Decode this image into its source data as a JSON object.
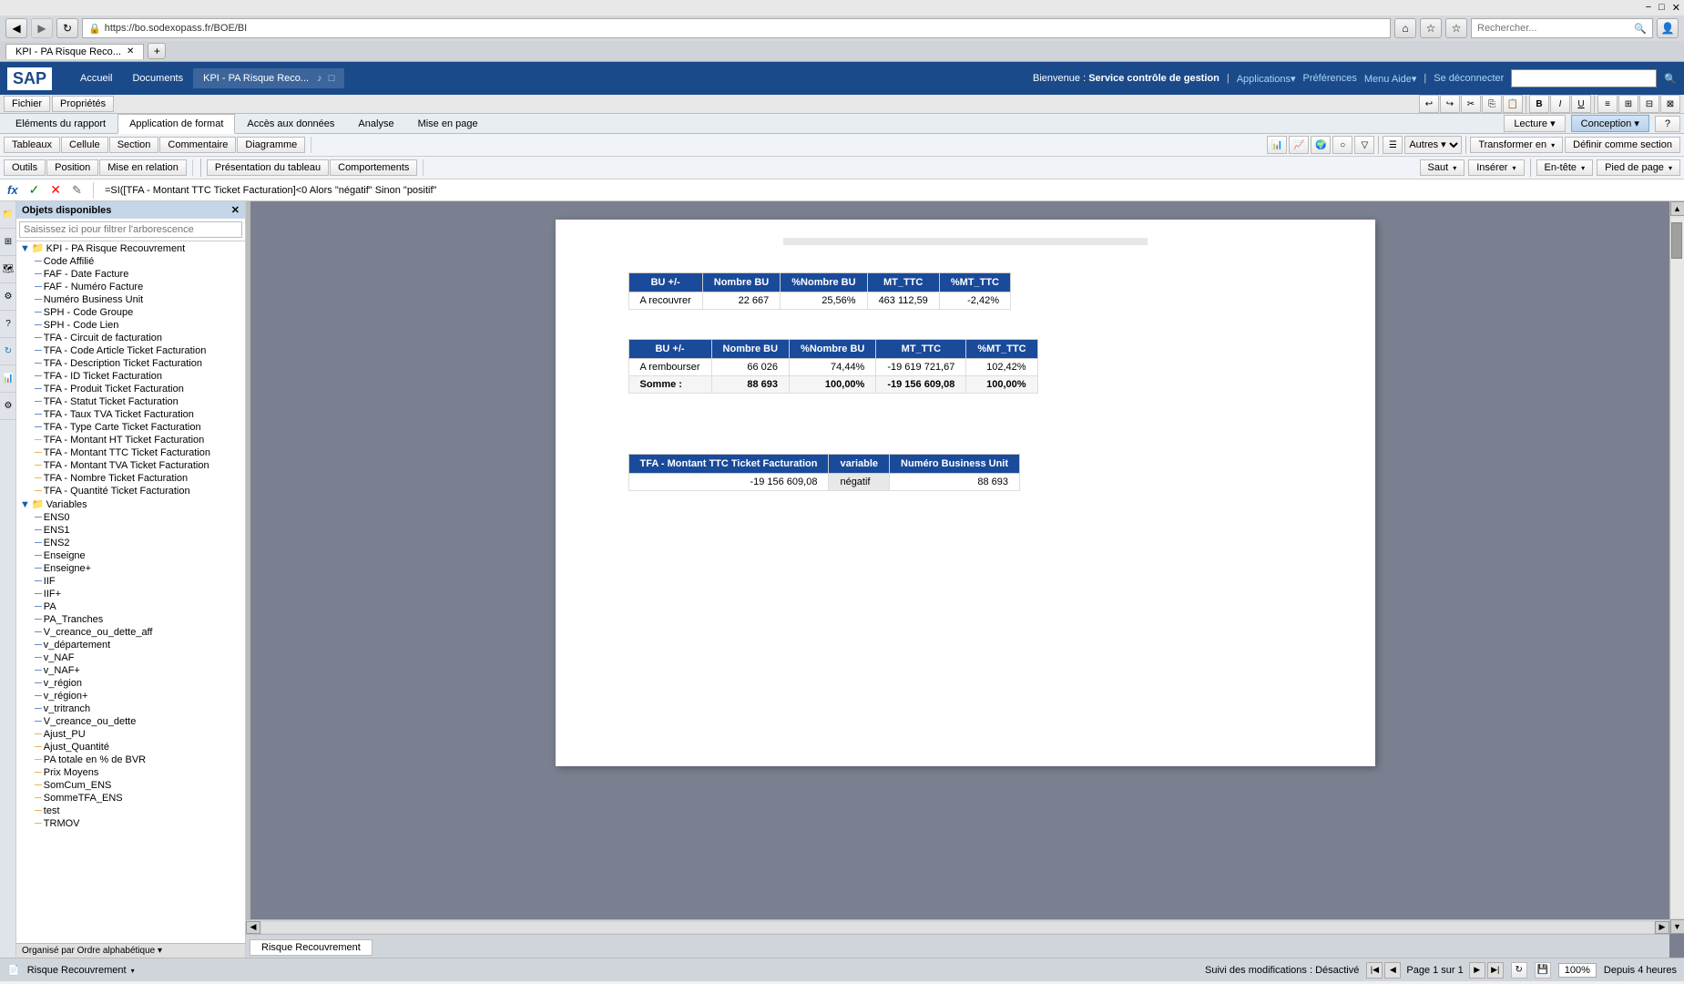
{
  "browser": {
    "url": "https://bo.sodexopass.fr/BOE/BI",
    "search_placeholder": "Rechercher...",
    "tab_title": "KPI - PA Risque Reco...",
    "minimize": "−",
    "maximize": "□",
    "close": "✕",
    "nav_back": "◀",
    "nav_forward": "▶",
    "nav_reload": "↻",
    "nav_home": "⌂",
    "fav_star": "☆",
    "fav_star2": "☆",
    "user_icon": "👤"
  },
  "sap": {
    "logo": "SAP",
    "welcome": "Bienvenue : Service contrôle de gestion",
    "menu_items": [
      "Accueil",
      "Documents"
    ],
    "kpi_tab": "KPI - PA Risque Reco...",
    "links": [
      "Applications▾",
      "Préférences",
      "Menu Aide▾",
      "|",
      "Se déconnecter"
    ]
  },
  "ribbon": {
    "tabs": [
      "Fichier",
      "Propriétés"
    ],
    "main_tabs": [
      "Eléments du rapport",
      "Application de format",
      "Accès aux données",
      "Analyse",
      "Mise en page"
    ],
    "active_main_tab": "Application de format",
    "sub_tabs1": [
      "Tableaux",
      "Cellule",
      "Section",
      "Commentaire",
      "Diagramme"
    ],
    "sub_tabs2_tools": [
      "Outils",
      "Position",
      "Mise en relation"
    ],
    "sub_tabs3": [
      "Présentation du tableau",
      "Comportements"
    ],
    "mode_buttons": [
      "Lecture",
      "Conception"
    ],
    "active_mode": "Conception",
    "help": "?"
  },
  "toolbar": {
    "formatting_btns": [
      "B",
      "I",
      "U"
    ],
    "insert_section": "Saut ▾",
    "insert": "Insérer ▾",
    "header": "En-tête ▾",
    "footer": "Pied de page ▾",
    "transform": "Transformer en ▾",
    "define_section": "Définir comme section",
    "others": "Autres ▾"
  },
  "formula_bar": {
    "fx": "fx",
    "check": "✓",
    "cancel": "✕",
    "formula": "=SI([TFA - Montant TTC Ticket Facturation]<0 Alors \"négatif\" Sinon \"positif\""
  },
  "left_panel": {
    "title": "Objets disponibles",
    "search_placeholder": "Saisissez ici pour filtrer l'arborescence",
    "root": "KPI - PA Risque Recouvrement",
    "items": [
      "Code Affilié",
      "FAF - Date Facture",
      "FAF - Numéro Facture",
      "Numéro Business Unit",
      "SPH - Code Groupe",
      "SPH - Code Lien",
      "TFA - Circuit de facturation",
      "TFA - Code Article Ticket Facturation",
      "TFA - Description Ticket Facturation",
      "TFA - ID Ticket Facturation",
      "TFA - Produit Ticket Facturation",
      "TFA - Statut Ticket Facturation",
      "TFA - Taux TVA Ticket Facturation",
      "TFA - Type Carte Ticket Facturation",
      "TFA - Montant HT Ticket Facturation",
      "TFA - Montant TTC Ticket Facturation",
      "TFA - Montant TVA Ticket Facturation",
      "TFA - Nombre Ticket Facturation",
      "TFA - Quantité Ticket Facturation"
    ],
    "variables_label": "Variables",
    "variables": [
      "ENS0",
      "ENS1",
      "ENS2",
      "Enseigne",
      "Enseigne+",
      "IIF",
      "IIF+",
      "PA",
      "PA_Tranches",
      "V_creance_ou_dette_aff",
      "v_département",
      "v_NAF",
      "v_NAF+",
      "v_région",
      "v_région+",
      "v_tritranch",
      "V_creance_ou_dette",
      "Ajust_PU",
      "Ajust_Quantité",
      "PA totale en % de BVR",
      "Prix Moyens",
      "SomCum_ENS",
      "SommeTFA_ENS",
      "test",
      "TRMOV"
    ],
    "footer": "Organisé par Ordre alphabétique ▾"
  },
  "table1": {
    "headers": [
      "BU +/-",
      "Nombre BU",
      "%Nombre BU",
      "MT_TTC",
      "%MT_TTC"
    ],
    "rows": [
      [
        "A recouvrer",
        "22 667",
        "25,56%",
        "463 112,59",
        "-2,42%"
      ]
    ]
  },
  "table2": {
    "headers": [
      "BU +/-",
      "Nombre BU",
      "%Nombre BU",
      "MT_TTC",
      "%MT_TTC"
    ],
    "rows": [
      [
        "A rembourser",
        "66 026",
        "74,44%",
        "-19 619 721,67",
        "102,42%"
      ],
      [
        "Somme :",
        "88 693",
        "100,00%",
        "-19 156 609,08",
        "100,00%"
      ]
    ]
  },
  "table3": {
    "headers": [
      "TFA - Montant TTC Ticket Facturation",
      "variable",
      "Numéro Business Unit"
    ],
    "rows": [
      [
        "-19 156 609,08",
        "négatif",
        "88 693"
      ]
    ]
  },
  "bottom_tabs": [
    "Risque Recouvrement"
  ],
  "status_bar": {
    "left": "Risque Recouvrement ▾",
    "suivi": "Suivi des modifications : Désactivé",
    "page_info": "Page 1 sur 1",
    "zoom": "100%",
    "time": "Depuis 4 heures"
  }
}
